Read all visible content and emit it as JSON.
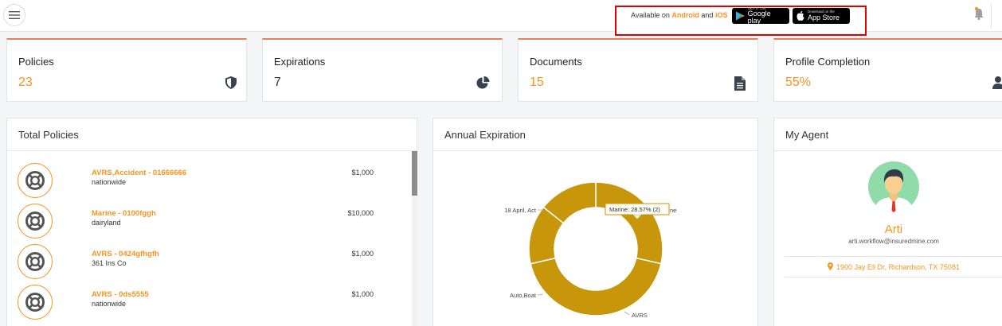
{
  "header": {
    "availability": {
      "prefix": "Available on",
      "android": "Android",
      "and": "and",
      "ios": "iOS"
    },
    "google_play": {
      "small": "GET IT ON",
      "big": "Google play"
    },
    "app_store": {
      "small": "Download on the",
      "big": "App Store"
    }
  },
  "stats": [
    {
      "label": "Policies",
      "value": "23",
      "icon": "shield-icon"
    },
    {
      "label": "Expirations",
      "value": "7",
      "icon": "pie-chart-icon"
    },
    {
      "label": "Documents",
      "value": "15",
      "icon": "document-icon"
    },
    {
      "label": "Profile Completion",
      "value": "55%",
      "icon": "user-icon"
    }
  ],
  "total_policies": {
    "title": "Total Policies",
    "rows": [
      {
        "name": "AVRS,Accident - 01666666",
        "company": "nationwide",
        "amount": "$1,000"
      },
      {
        "name": "Marine - 0100fggh",
        "company": "dairyland",
        "amount": "$10,000"
      },
      {
        "name": "AVRS - 0424gfhgfh",
        "company": "361 Ins Co",
        "amount": "$1,000"
      },
      {
        "name": "AVRS - 0ds5555",
        "company": "nationwide",
        "amount": "$1,000"
      }
    ]
  },
  "annual_expiration": {
    "title": "Annual Expiration",
    "tooltip": "Marine: 28.57% (2)",
    "labels": {
      "april": "18 April, Act",
      "auto_boat": "Auto,Boat",
      "avrs": "AVRS",
      "marine_tail": "ne"
    }
  },
  "chart_data": {
    "type": "pie",
    "title": "Annual Expiration",
    "donut": true,
    "color": "#c8960a",
    "slices": [
      {
        "label": "Marine",
        "percent": 28.57,
        "count": 2
      },
      {
        "label": "AVRS",
        "percent": 42.86,
        "count": 3
      },
      {
        "label": "Auto,Boat",
        "percent": 14.29,
        "count": 1
      },
      {
        "label": "18 April, Act",
        "percent": 14.29,
        "count": 1
      }
    ]
  },
  "agent": {
    "title": "My Agent",
    "name": "Arti",
    "email": "arti.workflow@insuredmine.com",
    "address": "1900 Jay Ell Dr, Richardson, TX 75081"
  },
  "colors": {
    "accent": "#f7931e",
    "card_border": "#f37d5a",
    "alert_box": "#e00000"
  }
}
